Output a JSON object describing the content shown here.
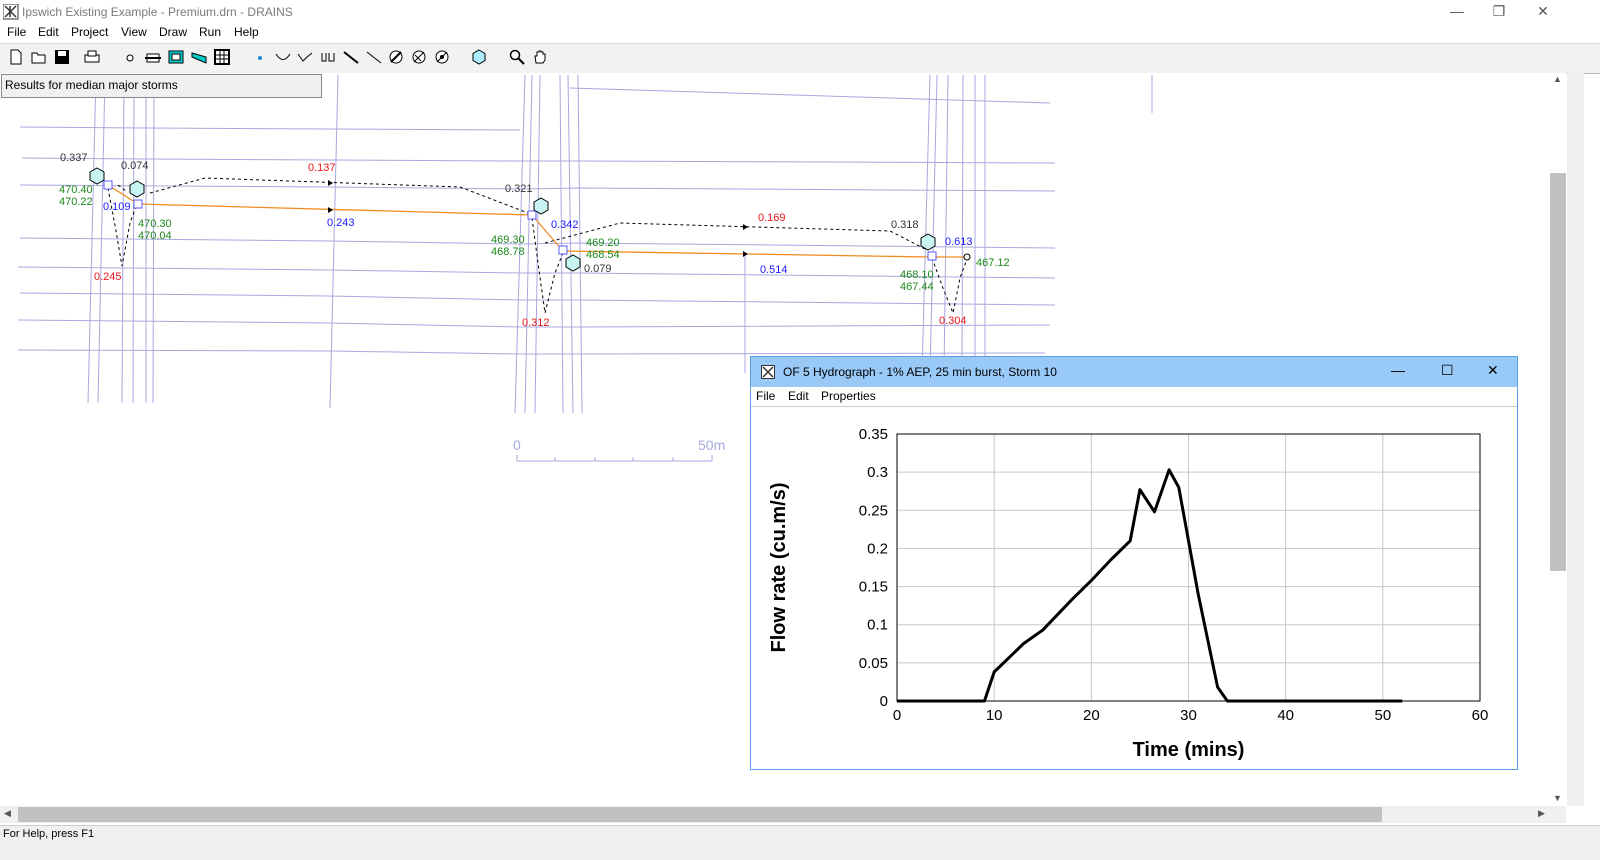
{
  "window": {
    "title": "Ipswich Existing Example - Premium.drn - DRAINS",
    "controls": [
      "—",
      "❐",
      "✕"
    ]
  },
  "menu": [
    "File",
    "Edit",
    "Project",
    "View",
    "Draw",
    "Run",
    "Help"
  ],
  "toolbar_icons": [
    "new-file-icon",
    "open-folder-icon",
    "save-icon",
    "print-icon",
    "node-icon",
    "pit-icon",
    "basin-icon",
    "channel-icon",
    "grid-icon",
    "junction-icon",
    "overflow-icon",
    "weir-icon",
    "culvert-icon",
    "link-icon",
    "diagonal-icon",
    "sub-catchment-icon",
    "sub-catchment-alt-icon",
    "detention-icon",
    "hexagon-icon",
    "zoom-icon",
    "pan-hand-icon"
  ],
  "canvas": {
    "results_label": "Results for median major storms",
    "labels": {
      "n1": "0.337",
      "n1_top": "470.40",
      "n1_bot": "470.22",
      "n2": "0.074",
      "n2_blue": "0.109",
      "n2_top": "470.30",
      "n2_bot": "470.04",
      "r1": "0.245",
      "mid1_red": "0.137",
      "mid1_blue": "0.243",
      "n3": "0.321",
      "n3_blue": "0.342",
      "n3_top": "469.30",
      "n3_bot": "468.78",
      "n4_top": "469.20",
      "n4_bot": "468.54",
      "n4": "0.079",
      "r2": "0.312",
      "mid2_red": "0.169",
      "mid2_blue": "0.514",
      "n5": "0.318",
      "n5_blue": "0.613",
      "n5_top": "468.10",
      "n5_bot": "467.44",
      "outlet": "467.12",
      "r3": "0.304"
    },
    "scale": {
      "start": "0",
      "end": "50m"
    }
  },
  "hydrograph": {
    "title": "OF 5 Hydrograph - 1% AEP, 25 min burst, Storm 10",
    "menu": [
      "File",
      "Edit",
      "Properties"
    ],
    "controls": [
      "—",
      "☐",
      "✕"
    ]
  },
  "chart_data": {
    "type": "line",
    "xlabel": "Time (mins)",
    "ylabel": "Flow rate (cu.m/s)",
    "xlim": [
      0,
      60
    ],
    "ylim": [
      0,
      0.35
    ],
    "xticks": [
      0,
      10,
      20,
      30,
      40,
      50,
      60
    ],
    "yticks": [
      0,
      0.05,
      0.1,
      0.15,
      0.2,
      0.25,
      0.3,
      0.35
    ],
    "xtick_labels": [
      "0",
      "10",
      "20",
      "30",
      "40",
      "50",
      "60"
    ],
    "ytick_labels": [
      "0",
      "0.05",
      "0.1",
      "0.15",
      "0.2",
      "0.25",
      "0.3",
      "0.35"
    ],
    "grid": true,
    "series": [
      {
        "x": [
          0,
          9,
          10,
          13,
          15,
          18,
          20,
          22,
          24,
          25,
          26.5,
          28,
          29,
          31,
          33,
          34,
          40,
          52
        ],
        "y": [
          0,
          0,
          0.038,
          0.075,
          0.093,
          0.133,
          0.158,
          0.185,
          0.21,
          0.277,
          0.248,
          0.303,
          0.28,
          0.14,
          0.018,
          0,
          0,
          0
        ]
      }
    ]
  },
  "status": "For Help, press F1"
}
